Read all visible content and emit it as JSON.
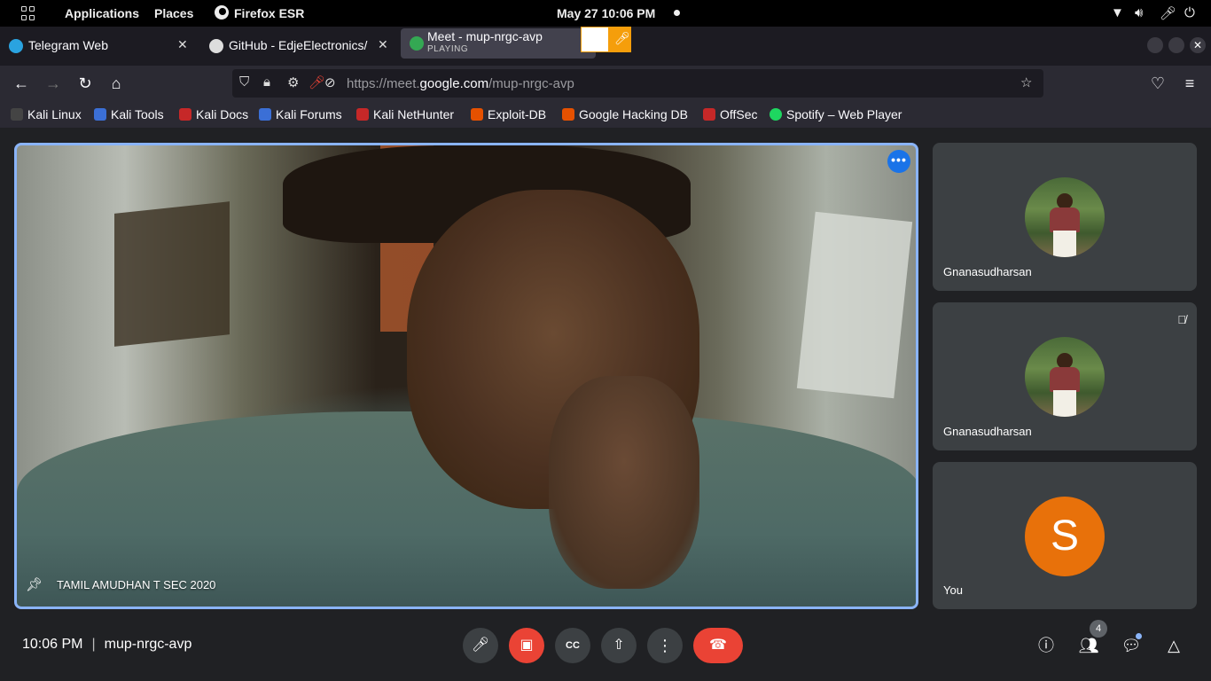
{
  "system_bar": {
    "activities_icon": "apps-grid-icon",
    "applications": "Applications",
    "places": "Places",
    "app_name": "Firefox ESR",
    "clock": "May 27  10:06 PM",
    "tray_icons": [
      "wifi-icon",
      "volume-icon",
      "mic-icon",
      "power-icon"
    ]
  },
  "tabs": [
    {
      "title": "Telegram Web",
      "favicon": "telegram-icon",
      "active": false
    },
    {
      "title": "GitHub - EdjeElectronics/",
      "favicon": "github-icon",
      "active": false
    },
    {
      "title": "Meet - mup-nrgc-avp",
      "subtitle": "PLAYING",
      "favicon": "meet-icon",
      "active": true
    }
  ],
  "navbar": {
    "url_prefix": "https://meet.",
    "url_domain": "google.com",
    "url_path": "/mup-nrgc-avp"
  },
  "bookmarks": [
    {
      "label": "Kali Linux",
      "color": "#444444"
    },
    {
      "label": "Kali Tools",
      "color": "#3b6fd6"
    },
    {
      "label": "Kali Docs",
      "color": "#c62828"
    },
    {
      "label": "Kali Forums",
      "color": "#3b6fd6"
    },
    {
      "label": "Kali NetHunter",
      "color": "#c62828"
    },
    {
      "label": "Exploit-DB",
      "color": "#e65100"
    },
    {
      "label": "Google Hacking DB",
      "color": "#e65100"
    },
    {
      "label": "OffSec",
      "color": "#c62828"
    },
    {
      "label": "Spotify – Web Player",
      "color": "#1ed760"
    }
  ],
  "meeting": {
    "main_participant": "TAMIL AMUDHAN T SEC 2020",
    "participants": [
      {
        "name": "Gnanasudharsan",
        "muted": false
      },
      {
        "name": "Gnanasudharsan",
        "muted": true
      },
      {
        "name": "You",
        "initial": "S",
        "muted": false
      }
    ],
    "time": "10:06 PM",
    "separator": "|",
    "code": "mup-nrgc-avp",
    "people_count": "4",
    "accent_color": "#8ab4f8",
    "end_call_color": "#ea4335",
    "you_avatar_color": "#e8710a"
  }
}
